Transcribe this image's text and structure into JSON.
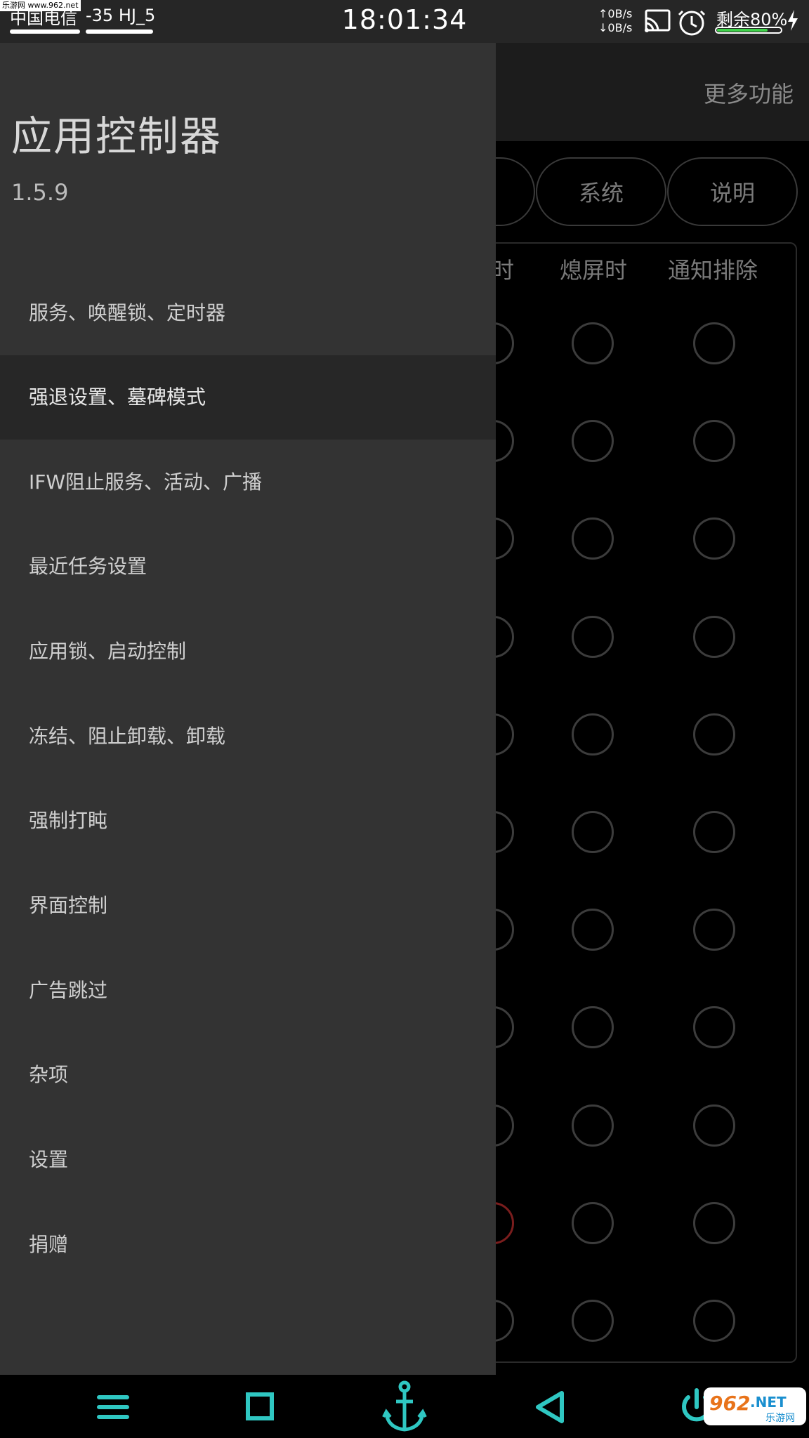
{
  "status_bar": {
    "watermark": "乐游网 www.962.net",
    "carrier": "中国电信",
    "signal": "-35 HJ_5(",
    "time": "18:01:34",
    "net_up": "↑0B/s",
    "net_down": "↓0B/s",
    "battery_text": "剩余80%",
    "battery_level": 0.8,
    "icons": [
      "cast-icon",
      "alarm-icon",
      "charging-bolt-icon"
    ]
  },
  "background_app": {
    "more_label": "更多功能",
    "tabs": [
      "系统",
      "说明"
    ],
    "column_headers": [
      "台时",
      "熄屏时",
      "通知排除"
    ],
    "rows": 11
  },
  "drawer": {
    "title": "应用控制器",
    "version": "1.5.9",
    "items": [
      {
        "label": "服务、唤醒锁、定时器"
      },
      {
        "label": "强退设置、墓碑模式",
        "selected": true
      },
      {
        "label": "IFW阻止服务、活动、广播"
      },
      {
        "label": "最近任务设置"
      },
      {
        "label": "应用锁、启动控制"
      },
      {
        "label": "冻结、阻止卸载、卸载"
      },
      {
        "label": "强制打盹"
      },
      {
        "label": "界面控制"
      },
      {
        "label": "广告跳过"
      },
      {
        "label": "杂项"
      },
      {
        "label": "设置"
      },
      {
        "label": "捐赠"
      }
    ]
  },
  "nav_bar": {
    "icons": [
      "menu-icon",
      "recents-square-icon",
      "anchor-icon",
      "back-triangle-icon",
      "power-icon"
    ],
    "accent": "#2fc7c2"
  },
  "brand_mark": {
    "big": "962",
    "big_suffix": ".NET",
    "small": "乐游网"
  }
}
